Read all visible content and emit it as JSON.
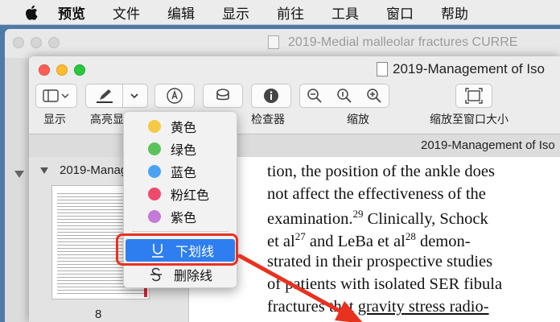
{
  "menubar": {
    "items": [
      "预览",
      "文件",
      "编辑",
      "显示",
      "前往",
      "工具",
      "窗口",
      "帮助"
    ]
  },
  "bg_window": {
    "title": "2019-Medial malleolar fractures  CURRE"
  },
  "window": {
    "title": "2019-Management of Iso"
  },
  "toolbar": {
    "labels": {
      "view": "显示",
      "highlight": "高亮显",
      "inspector": "检查器",
      "zoom": "缩放",
      "fit": "缩放至窗口大小"
    }
  },
  "tabbar": {
    "title": "2019-Management of Iso"
  },
  "sidebar": {
    "doc_title": "2019-Manag",
    "page_number": "8"
  },
  "popup": {
    "items": [
      {
        "label": "黄色",
        "color": "#f6c945"
      },
      {
        "label": "绿色",
        "color": "#5cc25b"
      },
      {
        "label": "蓝色",
        "color": "#4aa3f2"
      },
      {
        "label": "粉红色",
        "color": "#ee4a6d"
      },
      {
        "label": "紫色",
        "color": "#c47ad8"
      }
    ],
    "underline": "下划线",
    "strikethrough": "删除线"
  },
  "document": {
    "lines": [
      "tion, the position of the ankle does",
      "not affect the effectiveness of the",
      "examination.",
      "29",
      " Clinically, Schock",
      "et al",
      "27",
      " and LeBa et al",
      "28",
      " demon-",
      "strated in their prospective studies",
      "of patients with isolated SER fibula",
      "fractures that ",
      "gravity stress radio-"
    ]
  },
  "colors": {
    "selection": "#2e7ef0",
    "annotation": "#e8321f"
  }
}
